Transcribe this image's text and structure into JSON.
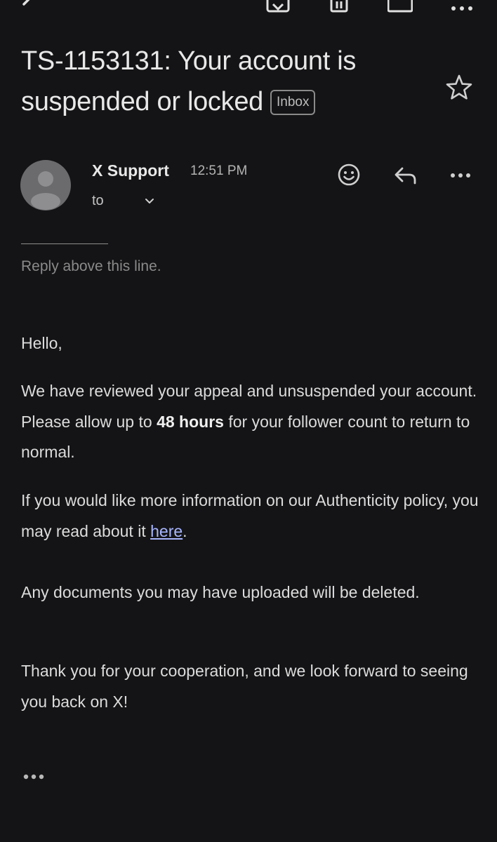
{
  "header": {
    "subject": "TS-1153131: Your account is suspended or locked",
    "label_badge": "Inbox"
  },
  "toolbar": {
    "icons": [
      "back-arrow-icon",
      "archive-icon",
      "delete-icon",
      "mail-icon",
      "more-vert-icon"
    ]
  },
  "message": {
    "sender_name": "X Support",
    "time": "12:51 PM",
    "to_label": "to",
    "separator": "________",
    "reply_above": "Reply above this line.",
    "greeting": "Hello,",
    "p1_before": "We have reviewed your appeal and unsuspended your account. Please allow up to ",
    "p1_bold": "48 hours",
    "p1_after": " for your follower count to return to normal.",
    "p2_before": "If you would like more information on our Authenticity policy, you may read about it ",
    "p2_link": "here",
    "p2_after": ".",
    "p3": "Any documents you may have uploaded will be deleted.",
    "p4": "Thank you for your cooperation, and we look forward to seeing you back on X!"
  },
  "colors": {
    "background": "#141416",
    "text": "#dcdcdc",
    "link": "#a8b6ff",
    "muted": "#8a8a8a"
  }
}
